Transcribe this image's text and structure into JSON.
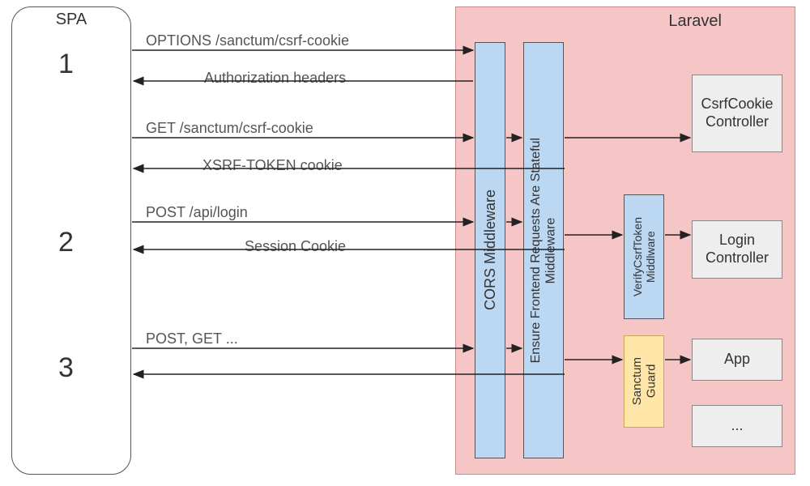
{
  "spa": {
    "title": "SPA"
  },
  "steps": {
    "s1": "1",
    "s2": "2",
    "s3": "3"
  },
  "laravel": {
    "title": "Laravel",
    "cors": "CORS Middleware",
    "ensure": "Ensure Frontend Requests Are Stateful\nMiddleware",
    "verify": "VerifyCsrfToken\nMiddlware",
    "sanctum": "Sanctum\nGuard",
    "csrf_ctrl": "CsrfCookie\nController",
    "login_ctrl": "Login\nController",
    "app_ctrl": "App",
    "ellipsis": "..."
  },
  "arrows": {
    "a1": "OPTIONS /sanctum/csrf-cookie",
    "a2": "Authorization headers",
    "a3": "GET /sanctum/csrf-cookie",
    "a4": "XSRF-TOKEN cookie",
    "a5": "POST /api/login",
    "a6": "Session Cookie",
    "a7": "POST, GET ..."
  }
}
